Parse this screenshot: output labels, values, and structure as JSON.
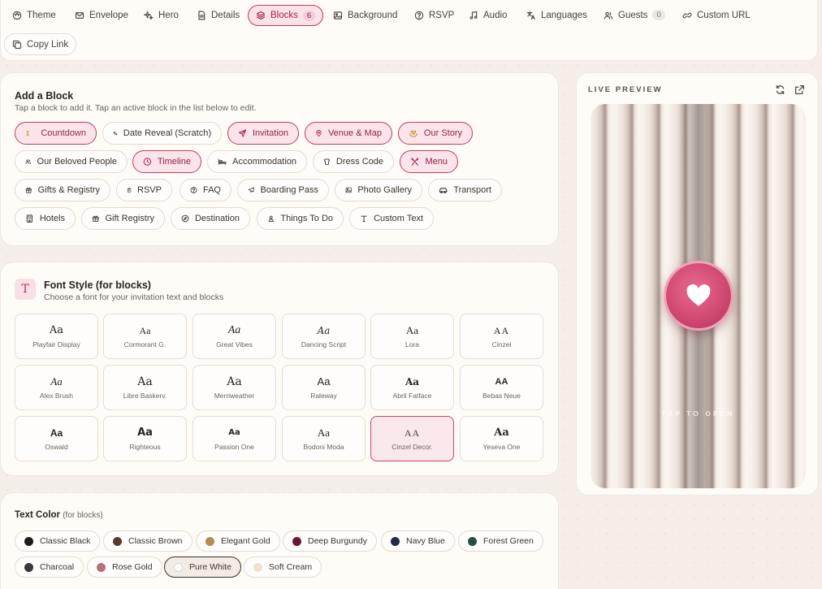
{
  "tabs": [
    {
      "label": "Theme",
      "icon": "palette-icon"
    },
    {
      "label": "Envelope",
      "icon": "envelope-icon"
    },
    {
      "label": "Hero",
      "icon": "sparkle-icon"
    },
    {
      "label": "Details",
      "icon": "document-icon"
    },
    {
      "label": "Blocks",
      "icon": "layers-icon",
      "badge": "6",
      "active": true
    },
    {
      "label": "Background",
      "icon": "image-icon"
    },
    {
      "label": "RSVP",
      "icon": "help-circle-icon"
    },
    {
      "label": "Audio",
      "icon": "music-icon"
    },
    {
      "label": "Languages",
      "icon": "translate-icon"
    },
    {
      "label": "Guests",
      "icon": "users-icon",
      "badge": "0"
    },
    {
      "label": "Custom URL",
      "icon": "link-icon"
    },
    {
      "label": "Copy Link",
      "icon": "copy-icon"
    }
  ],
  "add_block": {
    "title": "Add a Block",
    "subtitle": "Tap a block to add it. Tap an active block in the list below to edit.",
    "blocks": [
      {
        "label": "Countdown",
        "icon": "hourglass-icon",
        "active": true
      },
      {
        "label": "Date Reveal (Scratch)",
        "icon": "sparkle-icon",
        "active": false
      },
      {
        "label": "Invitation",
        "icon": "send-icon",
        "active": true
      },
      {
        "label": "Venue & Map",
        "icon": "map-pin-icon",
        "active": true
      },
      {
        "label": "Our Story",
        "icon": "hands-heart-icon",
        "active": true
      },
      {
        "label": "Our Beloved People",
        "icon": "users-icon",
        "active": false
      },
      {
        "label": "Timeline",
        "icon": "clock-icon",
        "active": true
      },
      {
        "label": "Accommodation",
        "icon": "bed-icon",
        "active": false
      },
      {
        "label": "Dress Code",
        "icon": "shirt-icon",
        "active": false
      },
      {
        "label": "Menu",
        "icon": "utensils-icon",
        "active": true
      },
      {
        "label": "Gifts & Registry",
        "icon": "gift-icon",
        "active": false
      },
      {
        "label": "RSVP",
        "icon": "clipboard-icon",
        "active": false
      },
      {
        "label": "FAQ",
        "icon": "help-circle-icon",
        "active": false
      },
      {
        "label": "Boarding Pass",
        "icon": "plane-icon",
        "active": false
      },
      {
        "label": "Photo Gallery",
        "icon": "image-icon",
        "active": false
      },
      {
        "label": "Transport",
        "icon": "car-icon",
        "active": false
      },
      {
        "label": "Hotels",
        "icon": "building-icon",
        "active": false
      },
      {
        "label": "Gift Registry",
        "icon": "gift-icon",
        "active": false
      },
      {
        "label": "Destination",
        "icon": "compass-icon",
        "active": false
      },
      {
        "label": "Things To Do",
        "icon": "person-pin-icon",
        "active": false
      },
      {
        "label": "Custom Text",
        "icon": "text-icon",
        "active": false
      }
    ]
  },
  "font_style": {
    "icon_letter": "T",
    "title": "Font Style (for blocks)",
    "subtitle": "Choose a font for your invitation text and blocks",
    "sample": "Aa",
    "fonts": [
      {
        "name": "Playfair Display"
      },
      {
        "name": "Cormorant G."
      },
      {
        "name": "Great Vibes"
      },
      {
        "name": "Dancing Script"
      },
      {
        "name": "Lora"
      },
      {
        "name": "Cinzel"
      },
      {
        "name": "Alex Brush"
      },
      {
        "name": "Libre Baskerv."
      },
      {
        "name": "Merriweather"
      },
      {
        "name": "Raleway"
      },
      {
        "name": "Abril Fatface"
      },
      {
        "name": "Bebas Neue"
      },
      {
        "name": "Oswald"
      },
      {
        "name": "Righteous"
      },
      {
        "name": "Passion One"
      },
      {
        "name": "Bodoni Moda"
      },
      {
        "name": "Cinzel Decor.",
        "selected": true
      },
      {
        "name": "Yeseva One"
      }
    ]
  },
  "text_color": {
    "title": "Text Color",
    "title_note": "(for blocks)",
    "colors": [
      {
        "label": "Classic Black",
        "hex": "#1f1b1a"
      },
      {
        "label": "Classic Brown",
        "hex": "#5a3a2c"
      },
      {
        "label": "Elegant Gold",
        "hex": "#b38b4e"
      },
      {
        "label": "Deep Burgundy",
        "hex": "#6e1631"
      },
      {
        "label": "Navy Blue",
        "hex": "#1e2a4a"
      },
      {
        "label": "Forest Green",
        "hex": "#22503e"
      },
      {
        "label": "Charcoal",
        "hex": "#3b3b3b"
      },
      {
        "label": "Rose Gold",
        "hex": "#b4727a"
      },
      {
        "label": "Pure White",
        "hex": "#ffffff",
        "selected": true
      },
      {
        "label": "Soft Cream",
        "hex": "#efe3cf"
      }
    ]
  },
  "preview": {
    "label": "LIVE PREVIEW",
    "tap_text": "TAP TO OPEN",
    "heart_icon": "heart-icon"
  }
}
